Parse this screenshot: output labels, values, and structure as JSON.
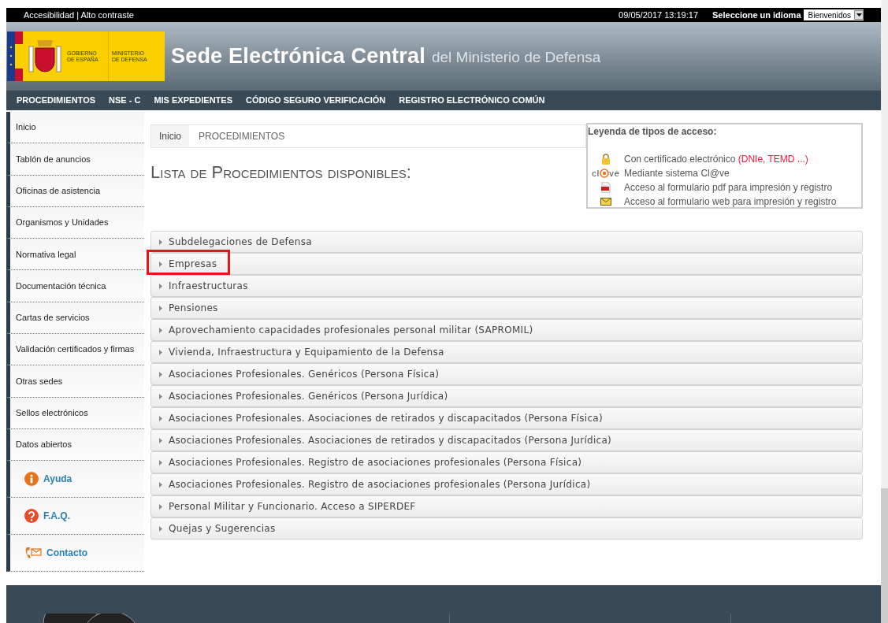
{
  "top_bar": {
    "accessibility": "Accesibilidad | Alto contraste",
    "datetime": "09/05/2017 13:19:17",
    "language_label": "Seleccione un idioma",
    "language_value": "Bienvenidos"
  },
  "header": {
    "logo_government": "GOBIERNO DE ESPAÑA",
    "logo_ministry": "MINISTERIO DE DEFENSA",
    "title": "Sede Electrónica Central",
    "subtitle": "del Ministerio de Defensa"
  },
  "nav": [
    "PROCEDIMIENTOS",
    "NSE - C",
    "MIS EXPEDIENTES",
    "CÓDIGO SEGURO VERIFICACIÓN",
    "REGISTRO ELECTRÓNICO COMÚN"
  ],
  "sidebar": {
    "items": [
      {
        "label": "Inicio",
        "kind": "link"
      },
      {
        "label": "Tablón de anuncios",
        "kind": "link"
      },
      {
        "label": "Oficinas de asistencia",
        "kind": "link"
      },
      {
        "label": "Organismos y Unidades",
        "kind": "link"
      },
      {
        "label": "Normativa legal",
        "kind": "link"
      },
      {
        "label": "Documentación técnica",
        "kind": "link"
      },
      {
        "label": "Cartas de servicios",
        "kind": "link"
      },
      {
        "label": "Validación certificados y firmas",
        "kind": "link"
      },
      {
        "label": "Otras sedes",
        "kind": "link"
      },
      {
        "label": "Sellos electrónicos",
        "kind": "link"
      },
      {
        "label": "Datos abiertos",
        "kind": "link"
      },
      {
        "label": "Ayuda",
        "kind": "info"
      },
      {
        "label": "F.A.Q.",
        "kind": "faq"
      },
      {
        "label": "Contacto",
        "kind": "contact"
      }
    ]
  },
  "breadcrumb": [
    "Inicio",
    "PROCEDIMIENTOS"
  ],
  "page_title": "Lista de Procedimientos disponibles:",
  "legend": {
    "title": "Leyenda de tipos de acceso:",
    "items": [
      {
        "kind": "lock",
        "text": "Con certificado electrónico",
        "note": "(DNIe, TEMD ...)"
      },
      {
        "kind": "clave",
        "logo": [
          "cl",
          "ve"
        ],
        "text": "Mediante sistema Cl@ve"
      },
      {
        "kind": "pdf",
        "text": "Acceso al formulario pdf para impresión y registro"
      },
      {
        "kind": "mail",
        "text": "Acceso al formulario web para impresión y registro"
      }
    ]
  },
  "procedures": [
    {
      "label": "Subdelegaciones de Defensa",
      "highlighted": false
    },
    {
      "label": "Empresas",
      "highlighted": true
    },
    {
      "label": "Infraestructuras",
      "highlighted": false
    },
    {
      "label": "Pensiones",
      "highlighted": false
    },
    {
      "label": "Aprovechamiento capacidades profesionales personal militar (SAPROMIL)",
      "highlighted": false
    },
    {
      "label": "Vivienda, Infraestructura y Equipamiento de la Defensa",
      "highlighted": false
    },
    {
      "label": "Asociaciones Profesionales. Genéricos (Persona Física)",
      "highlighted": false
    },
    {
      "label": "Asociaciones Profesionales. Genéricos (Persona Jurídica)",
      "highlighted": false
    },
    {
      "label": "Asociaciones Profesionales. Asociaciones de retirados y discapacitados (Persona Física)",
      "highlighted": false
    },
    {
      "label": "Asociaciones Profesionales. Asociaciones de retirados y discapacitados (Persona Jurídica)",
      "highlighted": false
    },
    {
      "label": "Asociaciones Profesionales. Registro de asociaciones profesionales (Persona Física)",
      "highlighted": false
    },
    {
      "label": "Asociaciones Profesionales. Registro de asociaciones profesionales (Persona Jurídica)",
      "highlighted": false
    },
    {
      "label": "Personal Militar y Funcionario. Acceso a SIPERDEF",
      "highlighted": false
    },
    {
      "label": "Quejas y Sugerencias",
      "highlighted": false
    }
  ]
}
